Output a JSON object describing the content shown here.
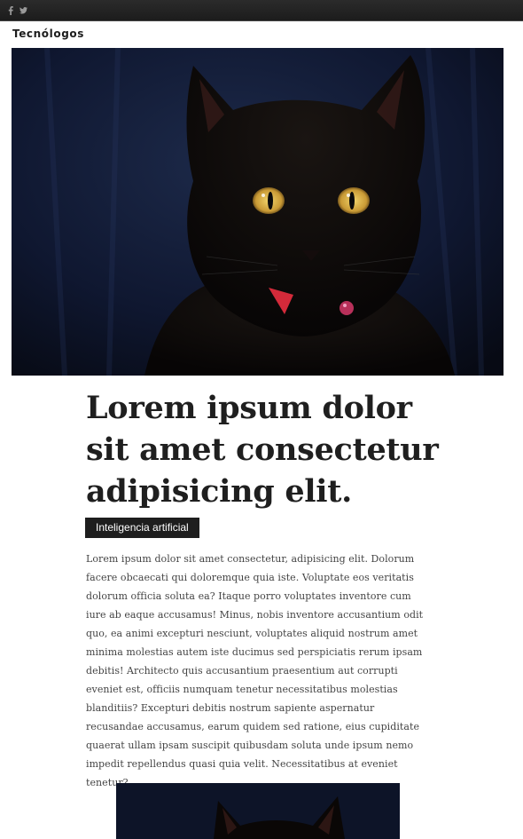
{
  "header": {
    "social": [
      {
        "icon": "facebook-icon",
        "glyph": "f"
      },
      {
        "icon": "twitter-icon",
        "glyph": "t"
      }
    ],
    "brand": "Tecnólogos"
  },
  "article": {
    "hero_image": "black-cat-photo",
    "title": "Lorem ipsum dolor sit amet consectetur adipisicing elit.",
    "tag": "Inteligencia artificial",
    "body": "Lorem ipsum dolor sit amet consectetur, adipisicing elit. Dolorum facere obcaecati qui doloremque quia iste. Voluptate eos veritatis dolorum officia soluta ea? Itaque porro voluptates inventore cum iure ab eaque accusamus! Minus, nobis inventore accusantium odit quo, ea animi excepturi nesciunt, voluptates aliquid nostrum amet minima molestias autem iste ducimus sed perspiciatis rerum ipsam debitis! Architecto quis accusantium praesentium aut corrupti eveniet est, officiis numquam tenetur necessitatibus molestias blanditiis? Excepturi debitis nostrum sapiente aspernatur recusandae accusamus, earum quidem sed ratione, eius cupiditate quaerat ullam ipsam suscipit quibusdam soluta unde ipsum nemo impedit repellendus quasi quia velit. Necessitatibus at eveniet tenetur?",
    "inline_image": "black-cat-photo"
  },
  "colors": {
    "topbar": "#1c1c1c",
    "tag_bg": "#1e1e1e",
    "eye": "#d9b44a",
    "collar": "#d42a3a"
  }
}
